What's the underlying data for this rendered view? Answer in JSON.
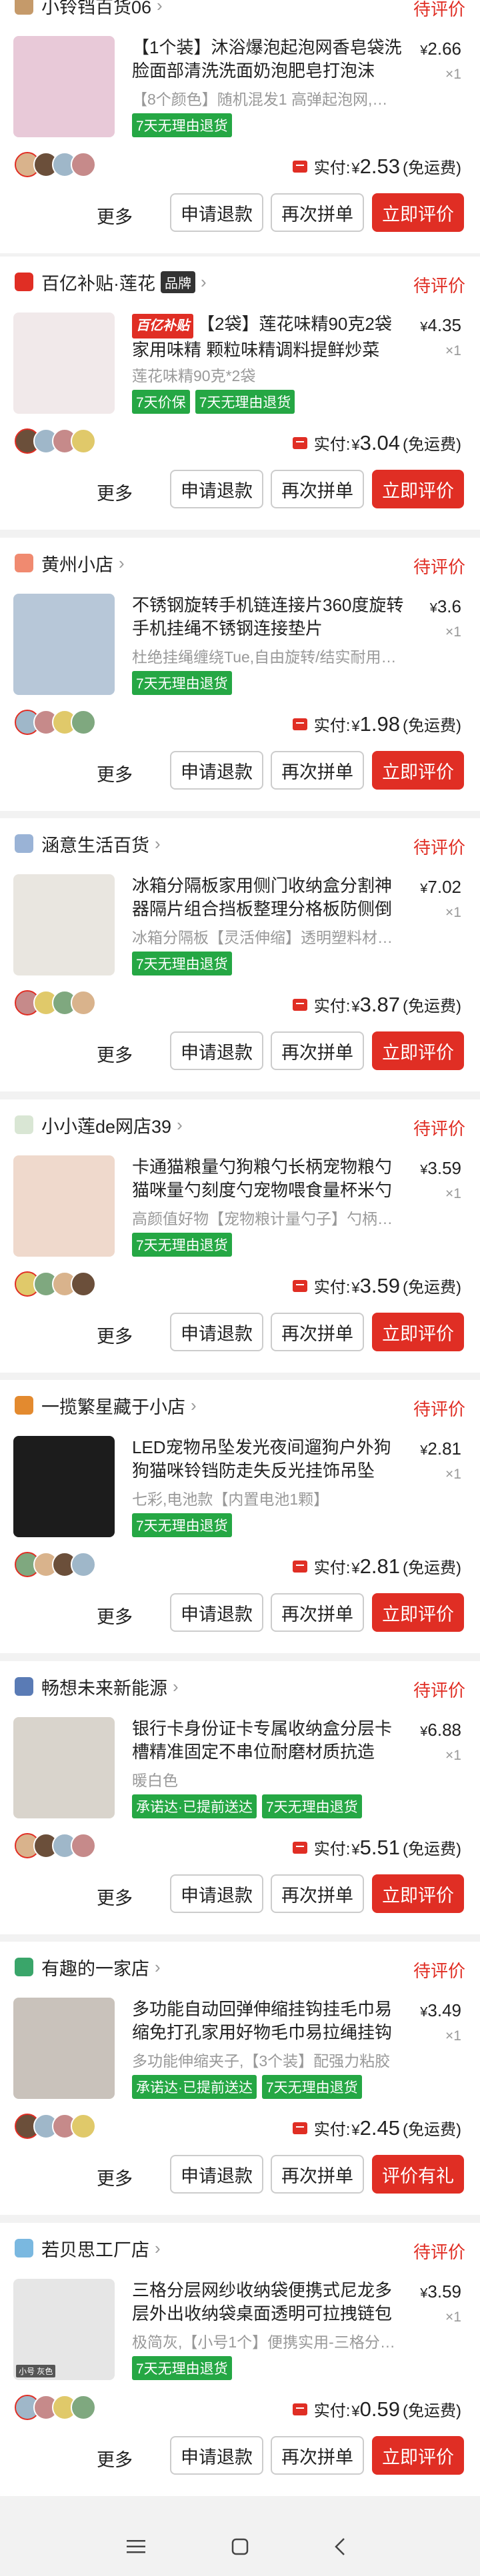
{
  "common": {
    "status": "待评价",
    "paid_label": "实付:",
    "yen": "¥",
    "free_shipping": "(免运费)",
    "more": "更多",
    "refund": "申请退款",
    "again": "再次拼单",
    "review": "立即评价",
    "qty": "×1",
    "seven_day": "7天无理由退货"
  },
  "orders": [
    {
      "shop": "小铃铛百货06",
      "title": "【1个装】沐浴爆泡起泡网香皂袋洗脸面部清洗洗面奶泡肥皂打泡沫",
      "sku": "【8个颜色】随机混发1 高弹起泡网,…",
      "tags": [
        "7天无理由退货"
      ],
      "price": "2.66",
      "paid": "2.53",
      "review": "立即评价",
      "thumb_color": "#e8c9d8",
      "shop_color": "#c59a6a"
    },
    {
      "shop": "百亿补贴·莲花",
      "brand": "品牌",
      "promo": "百亿补贴",
      "title": "【2袋】莲花味精90克2袋家用味精 颗粒味精调料提鲜炒菜",
      "sku": "莲花味精90克*2袋",
      "tags": [
        "7天价保",
        "7天无理由退货"
      ],
      "price": "4.35",
      "paid": "3.04",
      "review": "立即评价",
      "thumb_color": "#f1e9ea",
      "shop_color": "#e02e24"
    },
    {
      "shop": "黄州小店",
      "title": "不锈钢旋转手机链连接片360度旋转手机挂绳不锈钢连接垫片",
      "sku": "杜绝挂绳缠绕Tue,自由旋转/结实耐用…",
      "tags": [
        "7天无理由退货"
      ],
      "price": "3.6",
      "paid": "1.98",
      "review": "立即评价",
      "thumb_color": "#b7c7d8",
      "shop_color": "#f08a70"
    },
    {
      "shop": "涵意生活百货",
      "title": "冰箱分隔板家用侧门收纳盒分割神器隔片组合挡板整理分格板防侧倒",
      "sku": "冰箱分隔板【灵活伸缩】透明塑料材…",
      "tags": [
        "7天无理由退货"
      ],
      "price": "7.02",
      "paid": "3.87",
      "review": "立即评价",
      "thumb_color": "#e9e6e0",
      "shop_color": "#9ab3d6"
    },
    {
      "shop": "小小莲de网店39",
      "title": "卡通猫粮量勺狗粮勺长柄宠物粮勺猫咪量勺刻度勺宠物喂食量杯米勺",
      "sku": "高颜值好物【宠物粮计量勺子】勺柄…",
      "tags": [
        "7天无理由退货"
      ],
      "price": "3.59",
      "paid": "3.59",
      "review": "立即评价",
      "thumb_color": "#efd9cc",
      "shop_color": "#d9e6d4"
    },
    {
      "shop": "一揽繁星藏于小店",
      "title": "LED宠物吊坠发光夜间遛狗户外狗狗猫咪铃铛防走失反光挂饰吊坠",
      "sku": "七彩,电池款【内置电池1颗】",
      "tags": [
        "7天无理由退货"
      ],
      "price": "2.81",
      "paid": "2.81",
      "review": "立即评价",
      "thumb_color": "#1c1c1c",
      "shop_color": "#e38a2f"
    },
    {
      "shop": "畅想未来新能源",
      "title": "银行卡身份证卡专属收纳盒分层卡槽精准固定不串位耐磨材质抗造",
      "sku": "暖白色",
      "tags": [
        "承诺达·已提前送达",
        "7天无理由退货"
      ],
      "price": "6.88",
      "paid": "5.51",
      "review": "立即评价",
      "thumb_color": "#d9d4cc",
      "shop_color": "#5a7bb5"
    },
    {
      "shop": "有趣的一家店",
      "title": "多功能自动回弹伸缩挂钩挂毛巾易缩免打孔家用好物毛巾易拉绳挂钩",
      "sku": "多功能伸缩夹子,【3个装】配强力粘胶",
      "tags": [
        "承诺达·已提前送达",
        "7天无理由退货"
      ],
      "price": "3.49",
      "paid": "2.45",
      "review": "评价有礼",
      "thumb_color": "#c9c2bb",
      "shop_color": "#3aa56a"
    },
    {
      "shop": "若贝思工厂店",
      "title": "三格分层网纱收纳袋便携式尼龙多层外出收纳袋桌面透明可拉拽链包",
      "sku": "极简灰,【小号1个】便携实用-三格分…",
      "tags": [
        "7天无理由退货"
      ],
      "price": "3.59",
      "paid": "0.59",
      "review": "立即评价",
      "thumb_color": "#e6e6e6",
      "shop_color": "#7ab8e0",
      "thumb_caption": "小号 灰色"
    }
  ],
  "top_partial": {
    "shop": "小铃铛百货06",
    "status": "待评价"
  },
  "nav": {
    "menu_icon": "menu-icon",
    "home_icon": "home-square-icon",
    "back_icon": "back-chevron-icon"
  }
}
